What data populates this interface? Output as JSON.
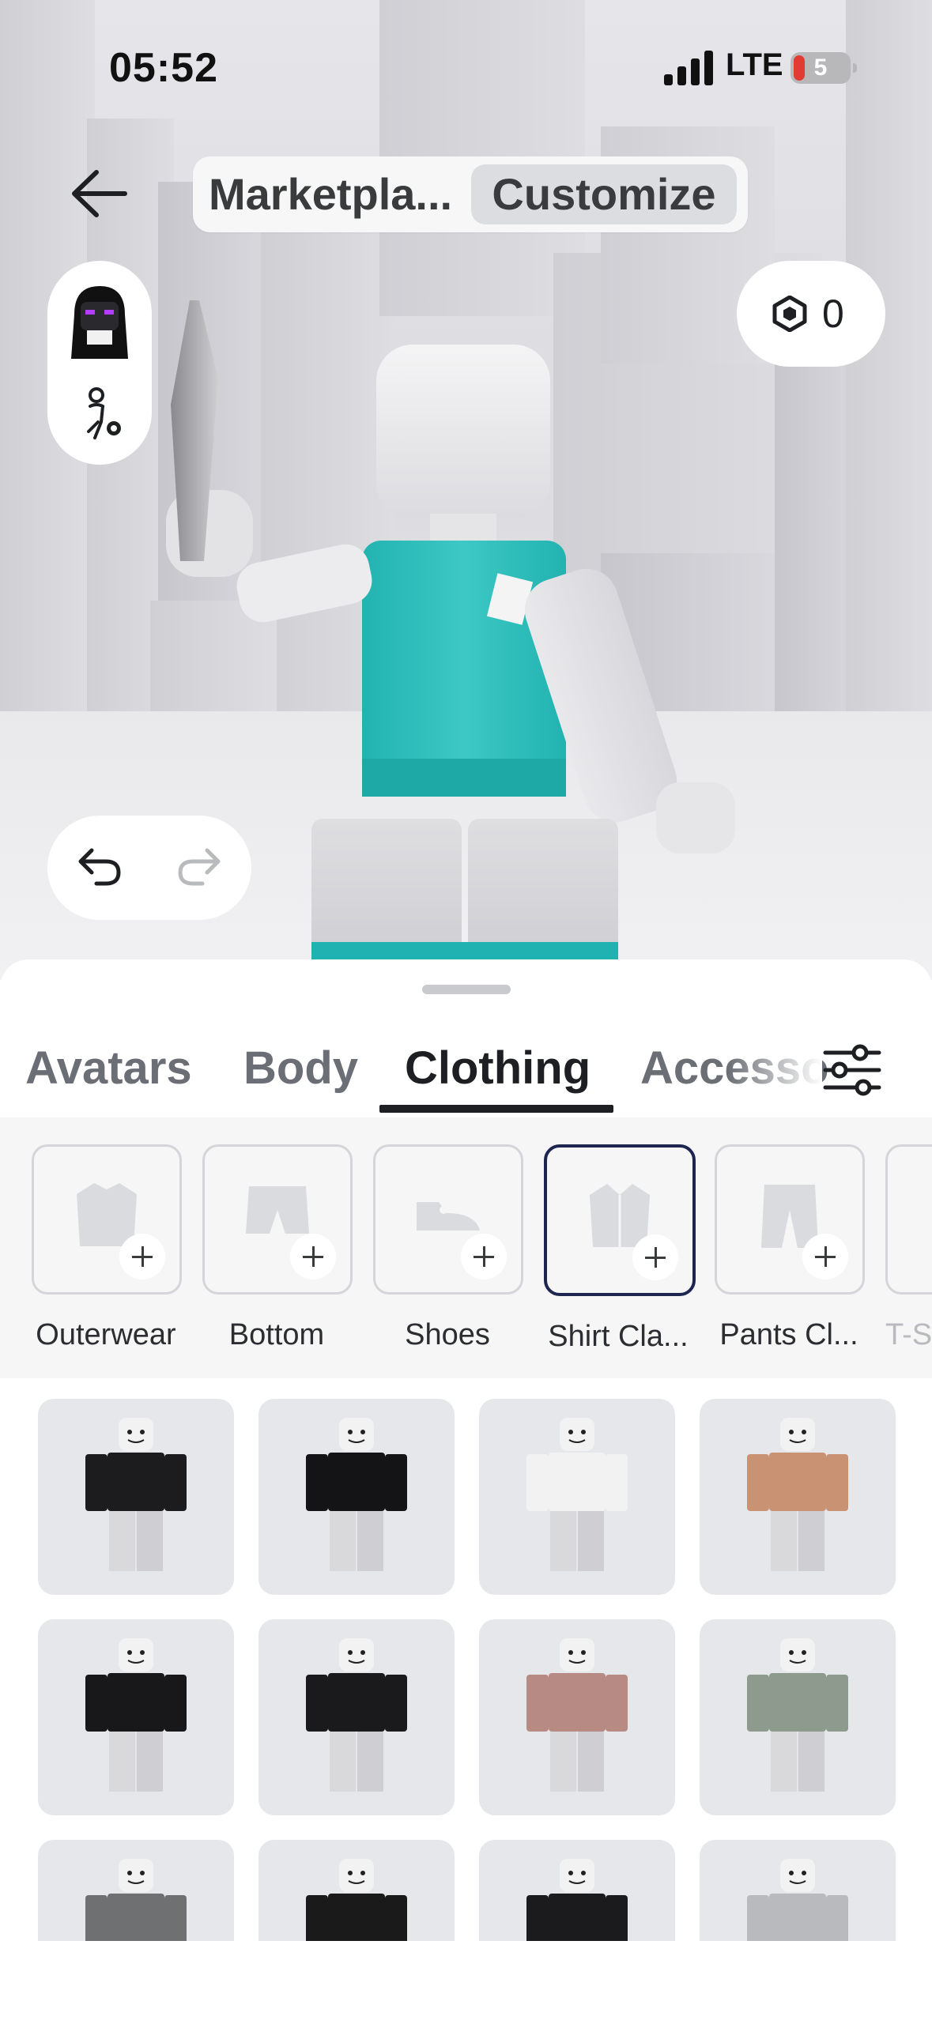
{
  "status_bar": {
    "time": "05:52",
    "network": "LTE",
    "battery_level": "5",
    "battery_color": "#e23b33"
  },
  "header": {
    "back_icon": "arrow-left-icon",
    "segments": [
      {
        "label": "Marketpla...",
        "selected": false
      },
      {
        "label": "Customize",
        "selected": true
      }
    ],
    "robux": {
      "icon": "robux-hexagon-icon",
      "balance": "0"
    }
  },
  "left_panel": {
    "avatar_icon": "avatar-headshot-icon",
    "settings_icon": "avatar-settings-icon"
  },
  "undo_redo": {
    "undo_icon": "undo-icon",
    "redo_icon": "redo-icon"
  },
  "tabs": [
    {
      "label": "Avatars",
      "active": false
    },
    {
      "label": "Body",
      "active": false
    },
    {
      "label": "Clothing",
      "active": true
    },
    {
      "label": "Accesso",
      "active": false
    }
  ],
  "filter_icon": "sliders-icon",
  "categories": [
    {
      "label": "Outerwear",
      "icon": "jacket-icon",
      "selected": false
    },
    {
      "label": "Bottom",
      "icon": "shorts-icon",
      "selected": false
    },
    {
      "label": "Shoes",
      "icon": "sneaker-icon",
      "selected": false
    },
    {
      "label": "Shirt Cla...",
      "icon": "shirt-icon",
      "selected": true
    },
    {
      "label": "Pants Cl...",
      "icon": "pants-icon",
      "selected": false
    },
    {
      "label": "T-S",
      "icon": "tshirt-icon",
      "selected": false
    }
  ],
  "items": [
    {
      "name": "black-shirt-with-graphic",
      "color": "#1c1c1e"
    },
    {
      "name": "black-jacket",
      "color": "#141416"
    },
    {
      "name": "white-shirt-with-anime-print",
      "color": "#f2f2f2"
    },
    {
      "name": "shirtless-torso",
      "color": "#c99273"
    },
    {
      "name": "black-fur-collar-coat",
      "color": "#18181a"
    },
    {
      "name": "black-leather-jacket",
      "color": "#1a1a1c"
    },
    {
      "name": "pink-plaid-shirt",
      "color": "#b78b84"
    },
    {
      "name": "green-plaid-shirt",
      "color": "#8f9a8f"
    },
    {
      "name": "grey-hoodie",
      "color": "#6e7072"
    },
    {
      "name": "black-biohazard-jacket",
      "color": "#1a1a1a"
    },
    {
      "name": "black-puffer-jacket",
      "color": "#1b1b1d"
    },
    {
      "name": "grey-puffer-jacket",
      "color": "#b8babd"
    }
  ],
  "avatar_shirt_color": "#2ab8b5"
}
